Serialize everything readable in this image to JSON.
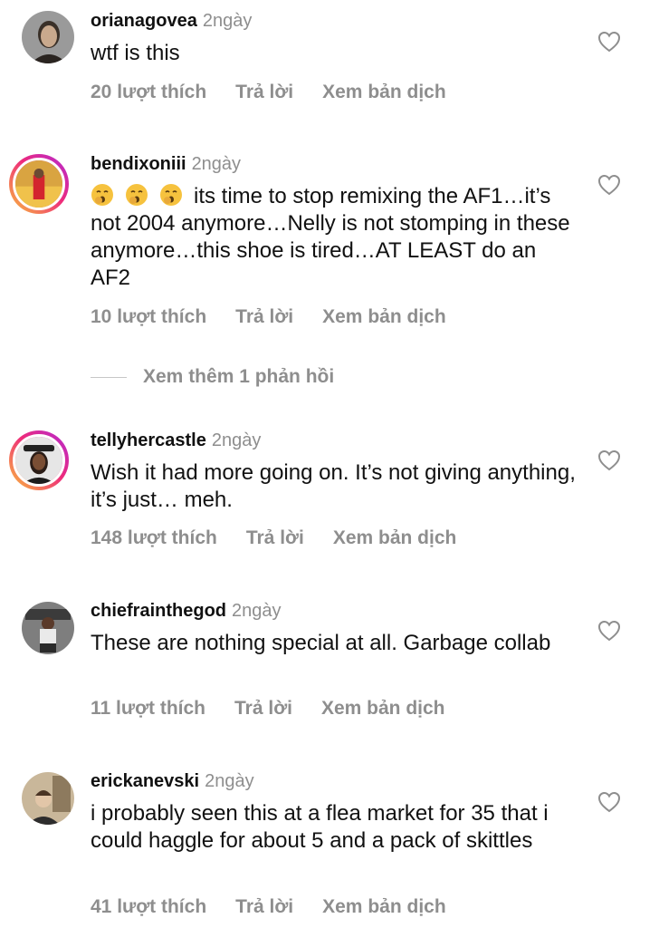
{
  "comments": [
    {
      "username": "orianagovea",
      "time": "2ngày",
      "text": "wtf is this",
      "likes": "20 lượt thích",
      "reply": "Trả lời",
      "translate": "Xem bản dịch"
    },
    {
      "username": "bendixoniii",
      "time": "2ngày",
      "text": "its time to stop remixing the AF1…it’s not 2004 anymore…Nelly is not stomping in these anymore…this shoe is tired…AT LEAST do an AF2",
      "likes": "10 lượt thích",
      "reply": "Trả lời",
      "translate": "Xem bản dịch"
    },
    {
      "username": "tellyhercastle",
      "time": "2ngày",
      "text": "Wish it had more going on. It’s not giving anything, it’s just… meh.",
      "likes": "148 lượt thích",
      "reply": "Trả lời",
      "translate": "Xem bản dịch"
    },
    {
      "username": "chiefrainthegod",
      "time": "2ngày",
      "text": "These are nothing special at all. Garbage collab",
      "likes": "11 lượt thích",
      "reply": "Trả lời",
      "translate": "Xem bản dịch"
    },
    {
      "username": "erickanevski",
      "time": "2ngày",
      "text": "i probably seen this at a flea market for 35 that i could haggle for about 5 and a pack of skittles",
      "likes": "41 lượt thích",
      "reply": "Trả lời",
      "translate": "Xem bản dịch"
    }
  ],
  "more_replies": "Xem thêm 1 phản hồi",
  "icons": {
    "like": "heart-outline-icon",
    "emoji": "yawning-face-emoji"
  },
  "colors": {
    "text": "#111111",
    "secondary": "#8e8e8e",
    "story_ring_start": "#f9c03b",
    "story_ring_end": "#b22ad6"
  }
}
